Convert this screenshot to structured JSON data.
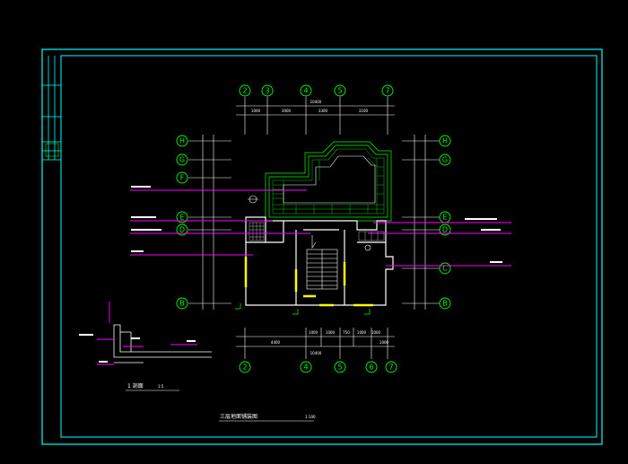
{
  "drawing": {
    "title": "三层地面铺装图",
    "scale": "1:100",
    "detail_title": "1 剖面",
    "detail_scale": "1:5",
    "frame_color": "#00ffff",
    "line_color": "#ffffff",
    "axis_color": "#00ff00",
    "leader_color": "#ff00ff",
    "wall_color": "#ffff00"
  },
  "axes": {
    "top": [
      "2",
      "3",
      "4",
      "5",
      "7"
    ],
    "bottom": [
      "2",
      "4",
      "5",
      "6",
      "7"
    ],
    "left": [
      "H",
      "G",
      "F",
      "E",
      "D",
      "B"
    ],
    "right": [
      "H",
      "G",
      "E",
      "D",
      "C",
      "B"
    ]
  },
  "dimensions": {
    "top_total": "10400",
    "top_segments": [
      "1000",
      "3000",
      "3300",
      "3100"
    ],
    "bottom_total": "10400",
    "bottom_segments": [
      "4400",
      "1000",
      "1000",
      "750",
      "1000",
      "1000",
      "1000"
    ]
  }
}
